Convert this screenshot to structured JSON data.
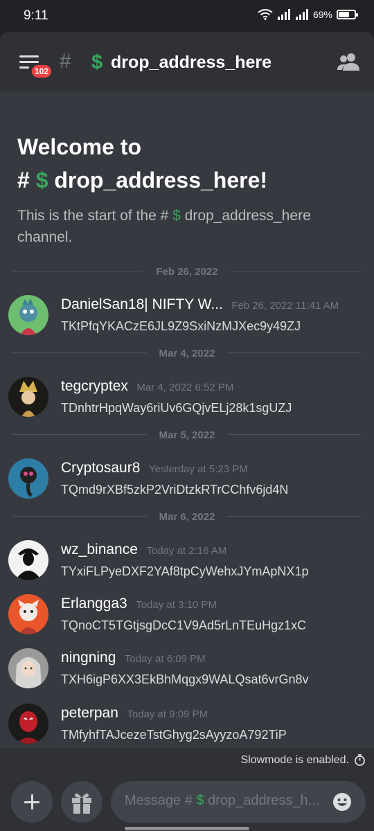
{
  "status_bar": {
    "time": "9:11",
    "battery": "69%",
    "battery_level": 0.69
  },
  "header": {
    "badge": "102",
    "hash": "#",
    "channel_emoji": "$",
    "channel_name": "drop_address_here"
  },
  "welcome": {
    "title_line1": "Welcome to",
    "title_hash": "#",
    "title_emoji": "$",
    "title_name": "drop_address_here!",
    "sub_prefix": "This is the start of the #",
    "sub_emoji": "$",
    "sub_suffix": "drop_address_here channel."
  },
  "dividers": [
    "Feb 26, 2022",
    "Mar 4, 2022",
    "Mar 5, 2022",
    "Mar 6, 2022"
  ],
  "messages": [
    {
      "name": "DanielSan18| NIFTY W...",
      "time": "Feb 26, 2022 11:41 AM",
      "text": "TKtPfqYKACzE6JL9Z9SxiNzMJXec9y49ZJ"
    },
    {
      "name": "tegcryptex",
      "time": "Mar 4, 2022 6:52 PM",
      "text": "TDnhtrHpqWay6riUv6GQjvELj28k1sgUZJ"
    },
    {
      "name": "Cryptosaur8",
      "time": "Yesterday at 5:23 PM",
      "text": "TQmd9rXBf5zkP2VriDtzkRTrCChfv6jd4N"
    },
    {
      "name": "wz_binance",
      "time": "Today at 2:16 AM",
      "text": "TYxiFLPyeDXF2YAf8tpCyWehxJYmApNX1p"
    },
    {
      "name": "Erlangga3",
      "time": "Today at 3:10 PM",
      "text": "TQnoCT5TGtjsgDcC1V9Ad5rLnTEuHgz1xC"
    },
    {
      "name": "ningning",
      "time": "Today at 6:09 PM",
      "text": "TXH6igP6XX3EkBhMqgx9WALQsat6vrGn8v"
    },
    {
      "name": "peterpan",
      "time": "Today at 9:09 PM",
      "text": "TMfyhfTAJcezeTstGhyg2sAyyzoA792TiP"
    }
  ],
  "slowmode": {
    "text": "Slowmode is enabled."
  },
  "composer": {
    "placeholder_prefix": "Message #",
    "placeholder_emoji": "$",
    "placeholder_suffix": "drop_address_h..."
  },
  "colors": {
    "accent_green": "#3ba55d",
    "badge_red": "#ed4245",
    "background": "#36393f"
  },
  "icons": [
    "menu-icon",
    "hash-icon",
    "members-icon",
    "timer-icon",
    "plus-icon",
    "gift-icon",
    "emoji-icon",
    "heart-icon"
  ]
}
